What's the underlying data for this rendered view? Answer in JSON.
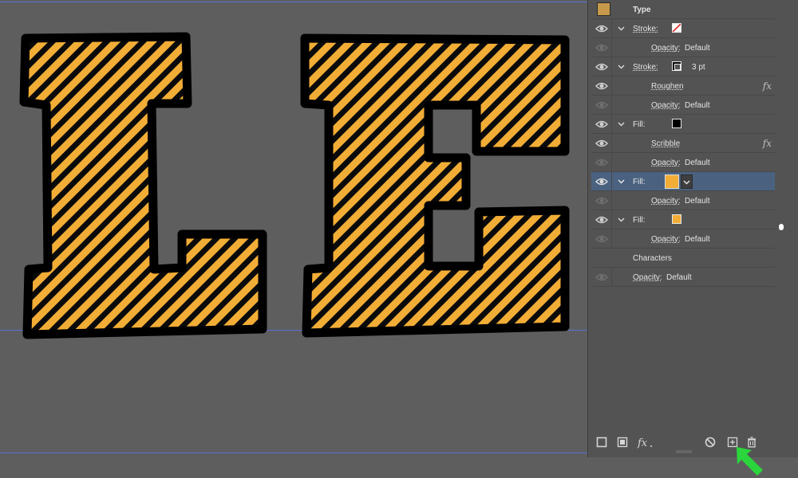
{
  "panel": {
    "type_label": "Type",
    "rows": [
      {
        "kind": "Stroke:",
        "swatch": "none-red-slash",
        "value": ""
      },
      {
        "kind": "Opacity:",
        "value": "Default"
      },
      {
        "kind": "Stroke:",
        "swatch": "black",
        "value": "3 pt"
      },
      {
        "kind": "Roughen",
        "fx": "fx"
      },
      {
        "kind": "Opacity:",
        "value": "Default"
      },
      {
        "kind": "Fill:",
        "swatch": "black"
      },
      {
        "kind": "Scribble",
        "fx": "fx"
      },
      {
        "kind": "Opacity:",
        "value": "Default"
      },
      {
        "kind": "Fill:",
        "swatch": "orange"
      },
      {
        "kind": "Opacity:",
        "value": "Default"
      },
      {
        "kind": "Fill:",
        "swatch": "orange"
      },
      {
        "kind": "Opacity:",
        "value": "Default"
      },
      {
        "kind": "Characters"
      },
      {
        "kind": "Opacity:",
        "value": "Default"
      }
    ]
  },
  "colors": {
    "canvas_bg": "#5e5e5e",
    "panel_bg": "#535353",
    "selected_row": "#4a6280",
    "letter_fill": "#f2ad36",
    "letter_stroke": "#000000",
    "guide": "#5b6fd8",
    "arrow": "#2bd63c"
  },
  "icons": {
    "bottom_bar": [
      "new-stroke-icon",
      "new-fill-icon",
      "fx-icon",
      "clear-appearance-icon",
      "duplicate-item-icon",
      "delete-icon"
    ]
  }
}
